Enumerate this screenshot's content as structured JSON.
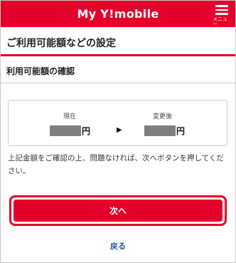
{
  "header": {
    "brand": "My Y!mobile",
    "menu_label": "メニュー",
    "accent_color": "#e4002b"
  },
  "page": {
    "title": "ご利用可能額などの設定"
  },
  "section": {
    "title": "利用可能額の確認"
  },
  "amounts": {
    "current_label": "現在",
    "after_label": "変更後",
    "current_unit": "円",
    "after_unit": "円",
    "arrow": "▶"
  },
  "notice": "上記金額をご確認の上、問題なければ、次へボタンを押してください。",
  "actions": {
    "next_label": "次へ",
    "back_label": "戻る"
  },
  "icons": {
    "menu": "hamburger-icon"
  }
}
